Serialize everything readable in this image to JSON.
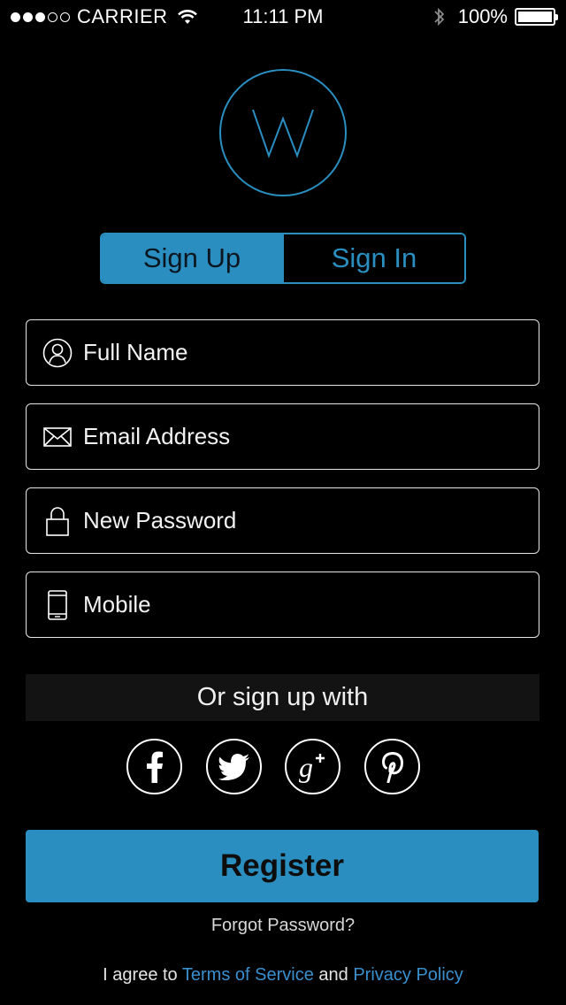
{
  "status_bar": {
    "carrier": "CARRIER",
    "time": "11:11 PM",
    "battery": "100%",
    "signal_bars": 3,
    "signal_total": 5
  },
  "logo": {
    "letter": "W"
  },
  "segmented": {
    "sign_up": "Sign Up",
    "sign_in": "Sign In",
    "selected": "sign_up"
  },
  "fields": {
    "full_name": {
      "placeholder": "Full Name",
      "value": ""
    },
    "email": {
      "placeholder": "Email Address",
      "value": ""
    },
    "password": {
      "placeholder": "New Password",
      "value": ""
    },
    "mobile": {
      "placeholder": "Mobile",
      "value": ""
    }
  },
  "social": {
    "heading": "Or sign up with",
    "networks": [
      "facebook-icon",
      "twitter-icon",
      "google-plus-icon",
      "pinterest-icon"
    ]
  },
  "register_label": "Register",
  "forgot_label": "Forgot Password?",
  "agreement": {
    "prefix": "I agree to",
    "terms": "Terms of Service",
    "conjunction": "and",
    "privacy": "Privacy Policy"
  },
  "colors": {
    "accent": "#2a8fc0",
    "link": "#3a8fcd",
    "background": "#000000"
  }
}
